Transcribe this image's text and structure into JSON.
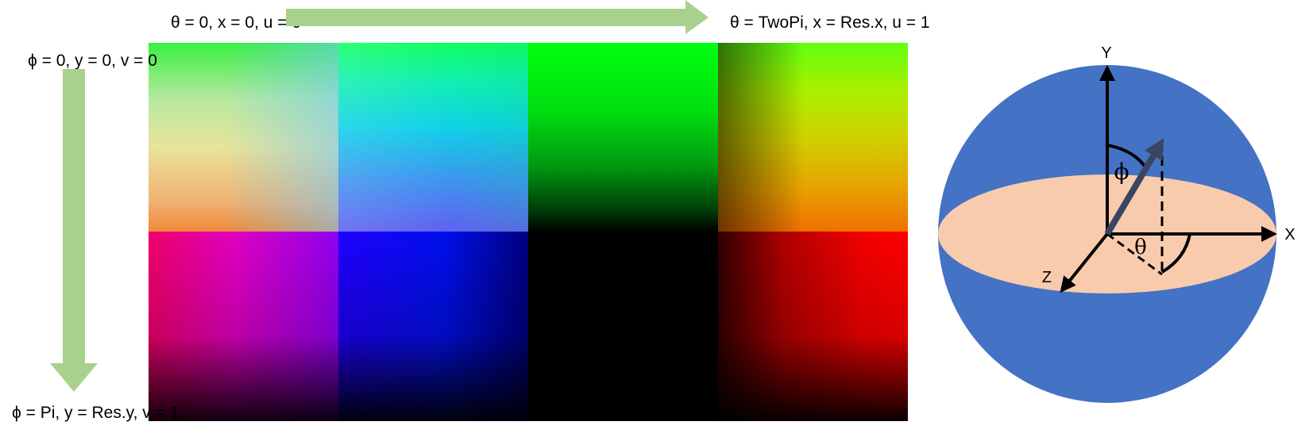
{
  "labels": {
    "top_left": "θ = 0, x = 0, u = 0",
    "top_right": "θ = TwoPi, x = Res.x, u = 1",
    "left_top": "ϕ = 0, y = 0, v = 0",
    "left_bottom": "ϕ = Pi, y = Res.y, v = 1"
  },
  "sphere": {
    "axis_y": "Y",
    "axis_x": "X",
    "axis_z": "Z",
    "angle_phi": "ϕ",
    "angle_theta": "θ"
  },
  "colors": {
    "arrow_green": "#a9d18e",
    "sphere_blue": "#4472c4",
    "equator_peach": "#f8cbad",
    "vector_dark": "#3a4660"
  }
}
